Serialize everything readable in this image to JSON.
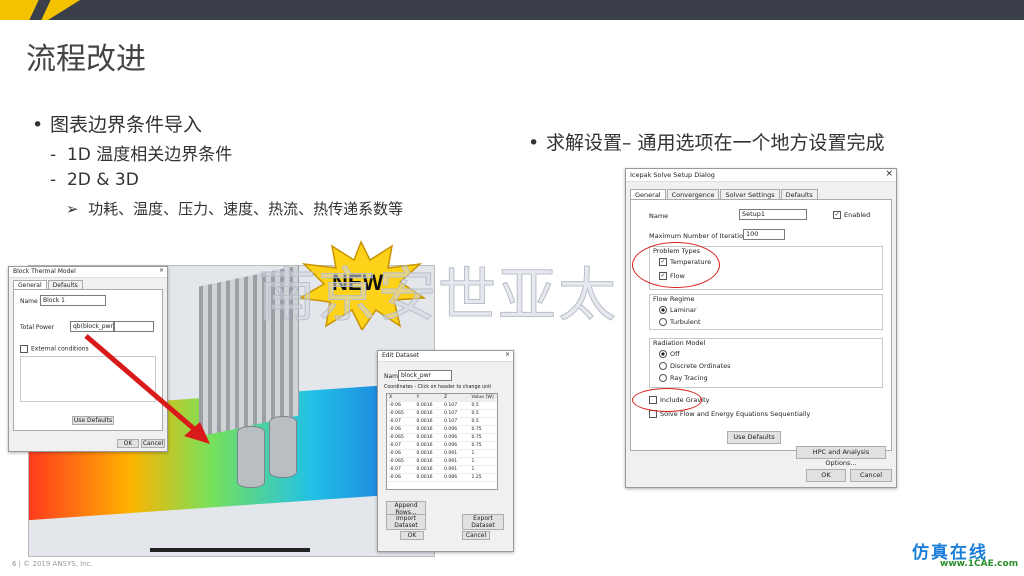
{
  "slide": {
    "title": "流程改进",
    "bullet1": "图表边界条件导入",
    "sub1": "1D 温度相关边界条件",
    "sub2": "2D & 3D",
    "sub3": "功耗、温度、压力、速度、热流、热传递系数等",
    "bullet2": "求解设置– 通用选项在一个地方设置完成",
    "new_badge": "NEW",
    "watermark": "南京安世亚太",
    "footer": "6  | © 2019 ANSYS, Inc.",
    "logo_main": "仿真在线",
    "logo_sub": "www.1CAE.com",
    "bullet_glyph": "•",
    "dash_glyph": "-",
    "arrow_glyph": "➢"
  },
  "block_dialog": {
    "title": "Block Thermal Model",
    "tabs": [
      "General",
      "Defaults"
    ],
    "name_label": "Name",
    "name_value": "Block 1",
    "total_power_label": "Total Power",
    "total_power_value": "qb(block_pwr_A_*_C)",
    "external_label": "External conditions",
    "ok": "OK",
    "cancel": "Cancel",
    "use_defaults": "Use Defaults"
  },
  "edit_dialog": {
    "title": "Edit Dataset",
    "name_label": "Name",
    "name_value": "block_pwr",
    "hint": "Coordinates - Click on header to change unit",
    "headers": [
      "X",
      "Y",
      "Z",
      "Value [W]"
    ],
    "rows": [
      [
        "-0.06",
        "0.0016",
        "0.107",
        "0.5"
      ],
      [
        "-0.065",
        "0.0016",
        "0.107",
        "0.5"
      ],
      [
        "-0.07",
        "0.0016",
        "0.107",
        "0.5"
      ],
      [
        "-0.06",
        "0.0016",
        "0.096",
        "0.75"
      ],
      [
        "-0.065",
        "0.0016",
        "0.096",
        "0.75"
      ],
      [
        "-0.07",
        "0.0016",
        "0.096",
        "0.75"
      ],
      [
        "-0.06",
        "0.0016",
        "0.091",
        "1"
      ],
      [
        "-0.065",
        "0.0016",
        "0.091",
        "1"
      ],
      [
        "-0.07",
        "0.0016",
        "0.091",
        "1"
      ],
      [
        "-0.06",
        "0.0016",
        "0.086",
        "1.25"
      ]
    ],
    "append": "Append Rows...",
    "import": "Import Dataset",
    "export": "Export Dataset",
    "ok": "OK",
    "cancel": "Cancel"
  },
  "ice_dialog": {
    "title": "Icepak Solve Setup Dialog",
    "tabs": [
      "General",
      "Convergence",
      "Solver Settings",
      "Defaults"
    ],
    "name_label": "Name",
    "name_value": "Setup1",
    "enabled_label": "Enabled",
    "max_iter_label": "Maximum Number of Iterations",
    "max_iter_value": "100",
    "problem_types": "Problem Types",
    "temperature": "Temperature",
    "flow": "Flow",
    "flow_regime": "Flow Regime",
    "laminar": "Laminar",
    "turbulent": "Turbulent",
    "radiation_model": "Radiation Model",
    "off": "Off",
    "discrete": "Discrete Ordinates",
    "ray": "Ray Tracing",
    "gravity": "Include Gravity",
    "seq": "Solve Flow and Energy Equations Sequentially",
    "use_defaults": "Use Defaults",
    "hpc": "HPC and Analysis Options...",
    "ok": "OK",
    "cancel": "Cancel",
    "check_mark": "✓",
    "close_glyph": "×"
  }
}
